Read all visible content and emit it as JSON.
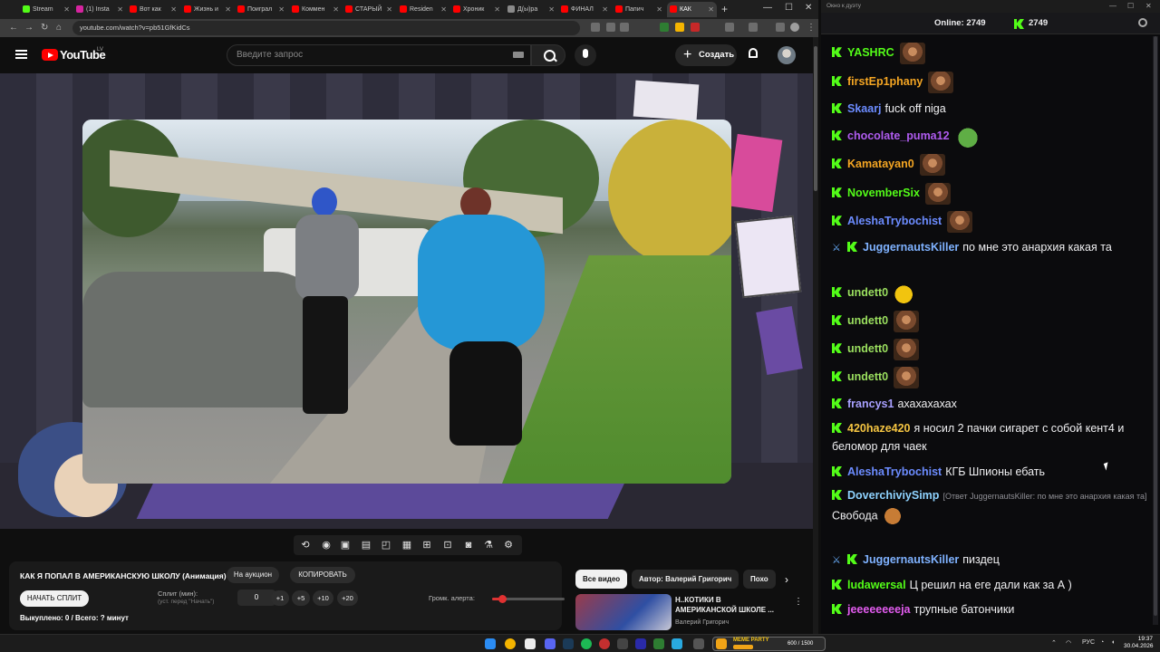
{
  "browser": {
    "tabs": [
      {
        "label": "Stream",
        "color": "#53fc18"
      },
      {
        "label": "(1) Insta",
        "color": "#d6249f"
      },
      {
        "label": "Вот как",
        "color": "#ff0000"
      },
      {
        "label": "Жизнь и",
        "color": "#ff0000"
      },
      {
        "label": "Поиграл",
        "color": "#ff0000"
      },
      {
        "label": "Коммен",
        "color": "#ff0000"
      },
      {
        "label": "СТАРЫЙ",
        "color": "#ff0000"
      },
      {
        "label": "Residen",
        "color": "#ff0000"
      },
      {
        "label": "Хроник",
        "color": "#ff0000"
      },
      {
        "label": "Д(ы)ра",
        "color": "#8a8a8a"
      },
      {
        "label": "ФИНАЛ",
        "color": "#ff0000"
      },
      {
        "label": "Папич",
        "color": "#ff0000"
      },
      {
        "label": "КАК",
        "color": "#ff0000"
      }
    ],
    "url": "youtube.com/watch?v=pb51GfKidCs"
  },
  "youtube": {
    "logo_text": "YouTube",
    "logo_region": "LV",
    "search_placeholder": "Введите запрос",
    "create_label": "Создать"
  },
  "toolbar": {
    "icons": [
      "repeat-icon",
      "broadcast-icon",
      "screen-video-icon",
      "film-icon",
      "picture-in-picture-icon",
      "subtitles-icon",
      "add-image-icon",
      "camera-icon",
      "flask-icon",
      "gear-icon"
    ]
  },
  "info": {
    "title": "КАК Я ПОПАЛ В АМЕРИКАНСКУЮ ШКОЛУ (Анимация)",
    "auction_label": "На аукцион",
    "copy_label": "КОПИРОВАТЬ",
    "start_split_label": "НАЧАТЬ СПЛИТ",
    "split_label": "Сплит (мин):",
    "split_hint": "(уст. перед \"Начать\")",
    "split_value": "0",
    "increments": [
      "+1",
      "+5",
      "+10",
      "+20"
    ],
    "alert_volume_label": "Громк. алерта:",
    "alert_volume_fraction": 0.14,
    "stats": "Выкуплено: 0 / Всего: ? минут"
  },
  "related": {
    "chips": [
      "Все видео",
      "Автор: Валерий Григорич",
      "Похо"
    ],
    "video_title": "Н..КОТИКИ В АМЕРИКАНСКОЙ ШКОЛЕ ...",
    "video_channel": "Валерий Григорич"
  },
  "chat": {
    "window_title": "Окно к дуэту",
    "online_label": "Online:",
    "online_count": "2749",
    "viewer_count": "2749",
    "messages": [
      {
        "user": "YASHRC",
        "color": "#53fc18",
        "text": "",
        "emote": "face"
      },
      {
        "user": "firstEp1phany",
        "color": "#f5a623",
        "text": "",
        "emote": "face"
      },
      {
        "user": "Skaarj",
        "color": "#6c8cff",
        "text": "fuck off niga",
        "emote": ""
      },
      {
        "user": "chocolate_puma12",
        "color": "#b05cf0",
        "text": "",
        "emote": "frog"
      },
      {
        "user": "Kamatayan0",
        "color": "#f5a623",
        "text": "",
        "emote": "face"
      },
      {
        "user": "NovemberSix",
        "color": "#53fc18",
        "text": "",
        "emote": "face"
      },
      {
        "user": "AleshaTrybochist",
        "color": "#6c8cff",
        "text": "",
        "emote": "face"
      },
      {
        "user": "JuggernautsKiller",
        "color": "#7fb2ff",
        "text": "по мне это анархия какая та",
        "emote": "",
        "mod": true
      },
      {
        "user": "undett0",
        "color": "#9be05f",
        "text": "",
        "emote": "moon"
      },
      {
        "user": "undett0",
        "color": "#9be05f",
        "text": "",
        "emote": "face"
      },
      {
        "user": "undett0",
        "color": "#9be05f",
        "text": "",
        "emote": "face"
      },
      {
        "user": "undett0",
        "color": "#9be05f",
        "text": "",
        "emote": "face"
      },
      {
        "user": "francys1",
        "color": "#a8a0ff",
        "text": "ахахахахах",
        "emote": ""
      },
      {
        "user": "420haze420",
        "color": "#f5c542",
        "text": "я носил 2 пачки сигарет с собой кент4 и беломор для чаек",
        "emote": ""
      },
      {
        "user": "AleshaTrybochist",
        "color": "#6c8cff",
        "text": "КГБ Шпионы ебать",
        "emote": ""
      },
      {
        "user": "DoverchiviySimp",
        "color": "#8fd3ff",
        "reply": "[Ответ JuggernautsKiller: по мне это анархия какая та]",
        "text": "Свобода",
        "emote": "dog"
      },
      {
        "user": "JuggernautsKiller",
        "color": "#7fb2ff",
        "text": "пиздец",
        "emote": "",
        "mod": true
      },
      {
        "user": "ludawersal",
        "color": "#53fc18",
        "text": "Ц решил на еге дали как за А )",
        "emote": ""
      },
      {
        "user": "jeeeeeeeeja",
        "color": "#e35cf0",
        "text": "трупные батончики",
        "emote": ""
      }
    ]
  },
  "taskbar": {
    "meme_label": "MEME PARTY",
    "meme_count": "600 / 1500",
    "lang": "РУС",
    "time": "19:37",
    "date": "30.04.2026"
  }
}
